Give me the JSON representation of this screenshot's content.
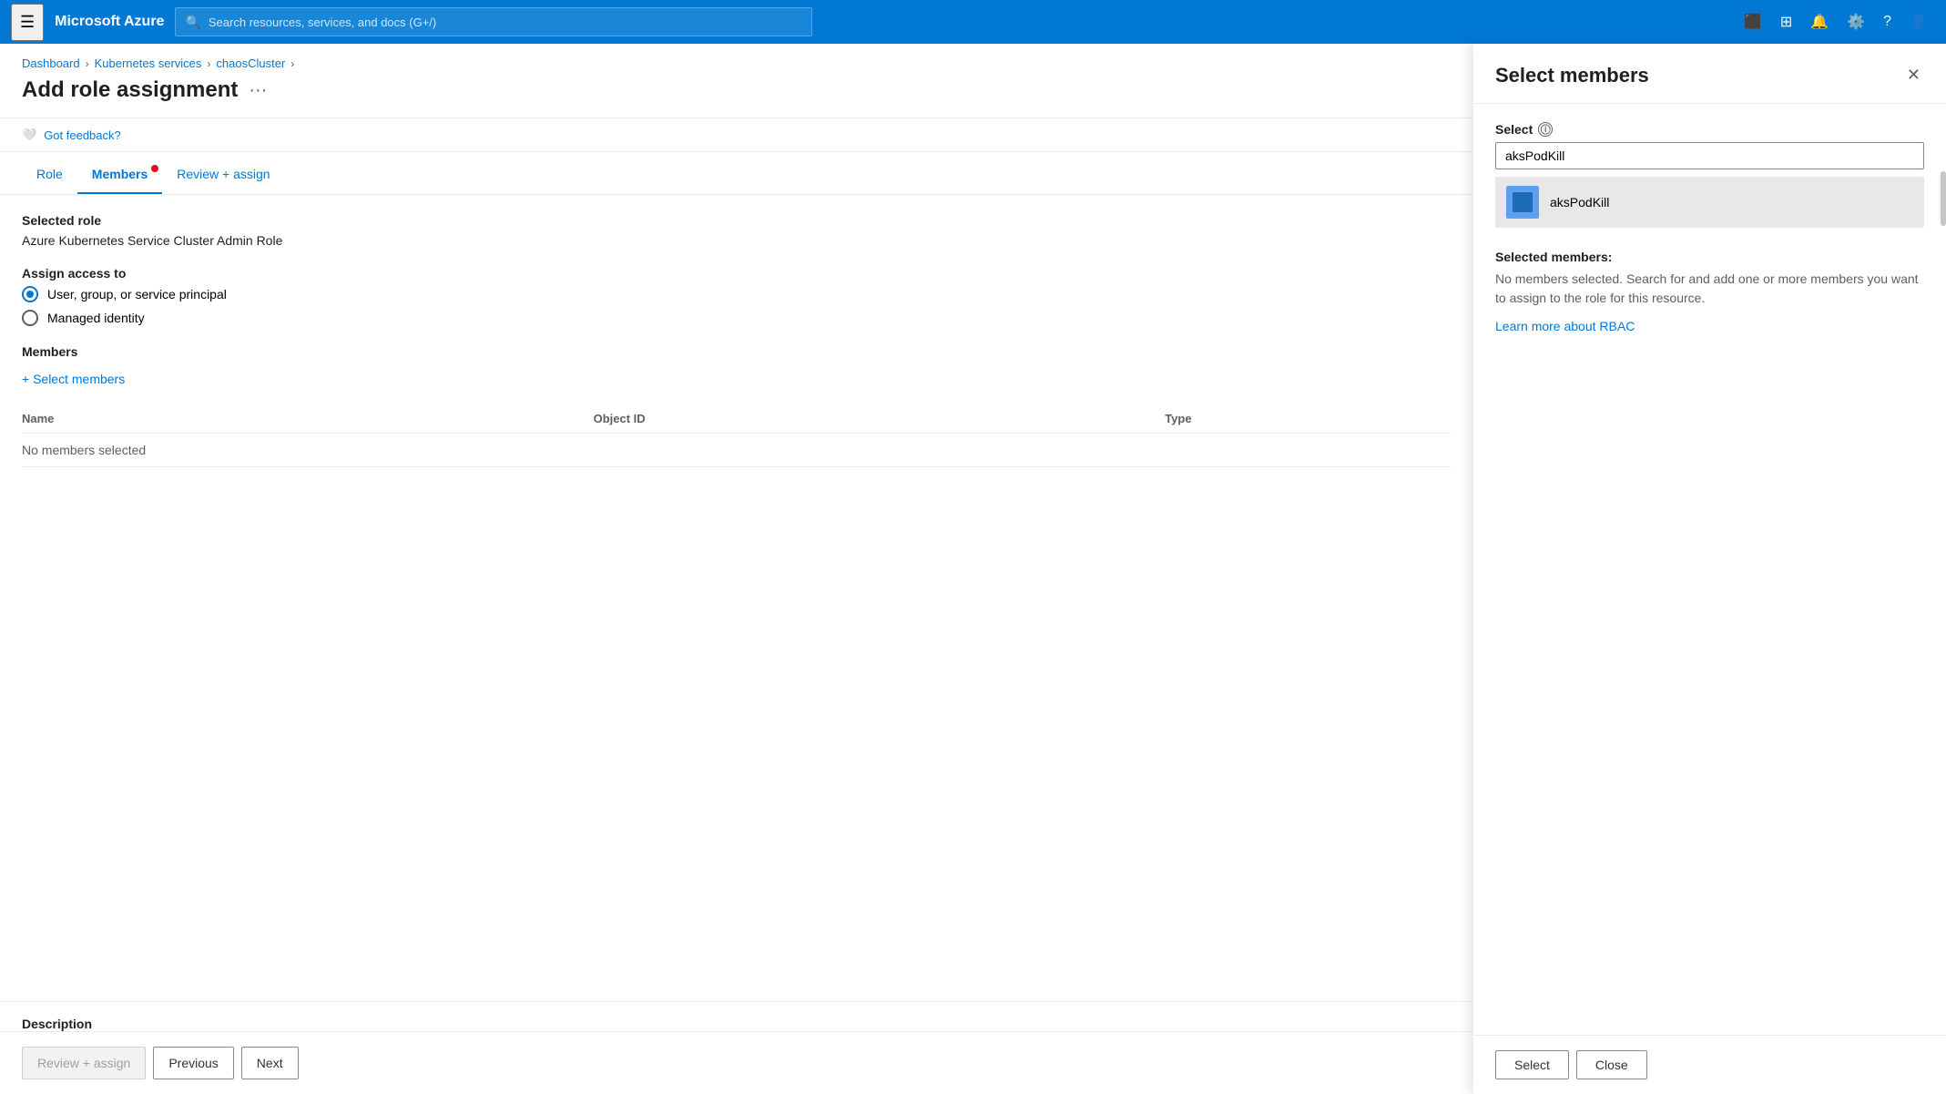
{
  "topnav": {
    "brand": "Microsoft Azure",
    "search_placeholder": "Search resources, services, and docs (G+/)",
    "icons": [
      "terminal",
      "cloud-shell",
      "bell",
      "settings",
      "help",
      "account"
    ]
  },
  "breadcrumb": {
    "items": [
      "Dashboard",
      "Kubernetes services",
      "chaosCluster"
    ],
    "separators": [
      ">",
      ">",
      ">"
    ]
  },
  "page": {
    "title": "Add role assignment",
    "more_icon": "···"
  },
  "feedback": {
    "label": "Got feedback?"
  },
  "tabs": [
    {
      "label": "Role",
      "active": false,
      "dot": false
    },
    {
      "label": "Members",
      "active": true,
      "dot": true
    },
    {
      "label": "Review + assign",
      "active": false,
      "dot": false
    }
  ],
  "content": {
    "selected_role_label": "Selected role",
    "selected_role_value": "Azure Kubernetes Service Cluster Admin Role",
    "assign_access_label": "Assign access to",
    "radio_options": [
      {
        "label": "User, group, or service principal",
        "selected": true
      },
      {
        "label": "Managed identity",
        "selected": false
      }
    ],
    "members_label": "Members",
    "select_members_link": "+ Select members",
    "table": {
      "columns": [
        "Name",
        "Object ID",
        "Type"
      ],
      "rows": [
        {
          "name": "No members selected",
          "object_id": "",
          "type": ""
        }
      ]
    },
    "description_label": "Description"
  },
  "bottom_bar": {
    "review_assign": "Review + assign",
    "previous": "Previous",
    "next": "Next"
  },
  "side_panel": {
    "title": "Select members",
    "close_icon": "✕",
    "select_label": "Select",
    "search_value": "aksPodKill",
    "search_placeholder": "",
    "results": [
      {
        "name": "aksPodKill",
        "icon_type": "service-principal"
      }
    ],
    "selected_info_title": "Selected members:",
    "selected_info_text": "No members selected. Search for and add one or more members you want to assign to the role for this resource.",
    "rbac_link": "Learn more about RBAC",
    "footer_buttons": [
      {
        "label": "Select",
        "type": "primary"
      },
      {
        "label": "Close",
        "type": "secondary"
      }
    ]
  }
}
